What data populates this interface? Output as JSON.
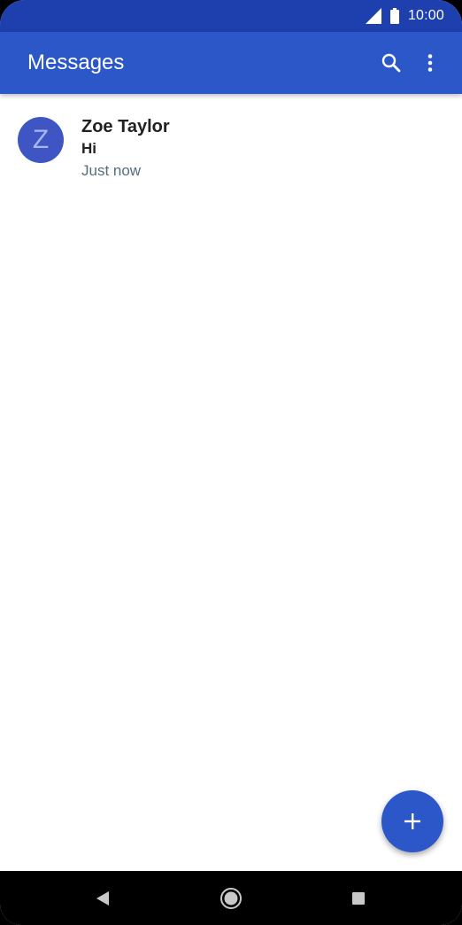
{
  "status_bar": {
    "time": "10:00",
    "icons": [
      "cell-signal-icon",
      "battery-icon"
    ]
  },
  "app_bar": {
    "title": "Messages",
    "actions": [
      "search-icon",
      "more-vert-icon"
    ]
  },
  "conversations": [
    {
      "avatar_letter": "Z",
      "name": "Zoe Taylor",
      "snippet": "Hi",
      "time": "Just now"
    }
  ],
  "fab": {
    "icon": "plus-icon"
  },
  "nav_bar": {
    "icons": [
      "back-icon",
      "home-icon",
      "recents-icon"
    ]
  },
  "colors": {
    "status_bar": "#1e3fae",
    "app_bar": "#2b57c8",
    "avatar": "#3f55c4",
    "fab": "#2b57c8",
    "timestamp": "#546e7a"
  }
}
